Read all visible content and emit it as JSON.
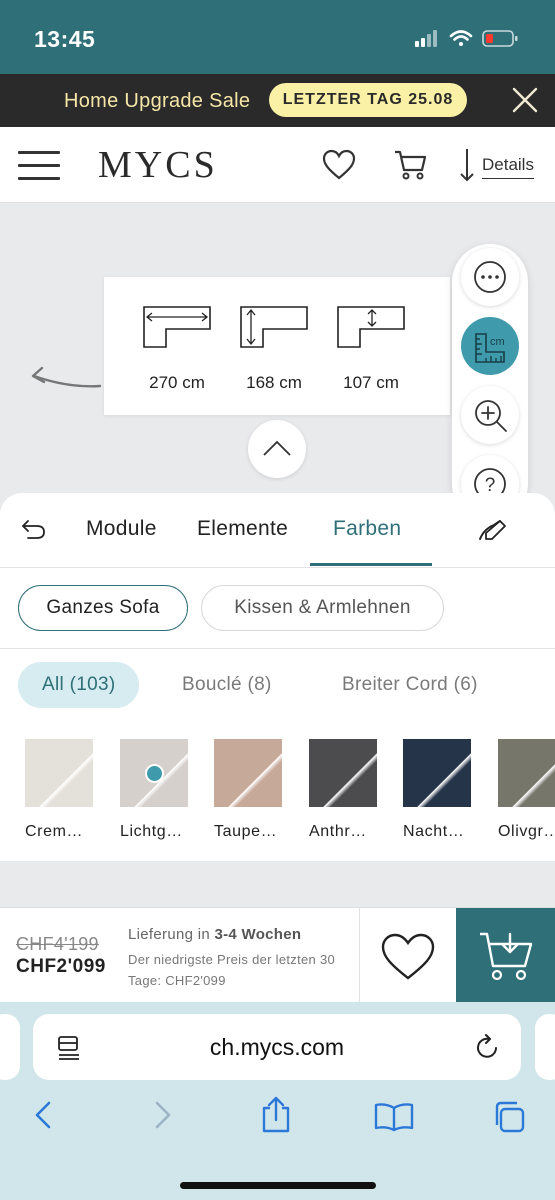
{
  "status_bar": {
    "time": "13:45"
  },
  "promo": {
    "text": "Home Upgrade Sale",
    "badge": "LETZTER TAG 25.08"
  },
  "header": {
    "logo": "MYCS",
    "details_label": "Details"
  },
  "dimensions": [
    {
      "label": "270 cm",
      "icon": "width-dimension-icon"
    },
    {
      "label": "168 cm",
      "icon": "depth-dimension-icon"
    },
    {
      "label": "107 cm",
      "icon": "seat-depth-dimension-icon"
    }
  ],
  "tool_rail": {
    "items": [
      {
        "icon": "more-options-icon"
      },
      {
        "icon": "measure-cm-icon",
        "text": "cm",
        "active": true
      },
      {
        "icon": "zoom-in-icon"
      },
      {
        "icon": "help-icon",
        "text": "?"
      }
    ]
  },
  "tabs": [
    {
      "label": "Module"
    },
    {
      "label": "Elemente"
    },
    {
      "label": "Farben",
      "active": true
    }
  ],
  "segments": [
    {
      "label": "Ganzes Sofa",
      "active": true
    },
    {
      "label": "Kissen & Armlehnen"
    }
  ],
  "filters": [
    {
      "label": "All (103)",
      "active": true
    },
    {
      "label": "Bouclé (8)"
    },
    {
      "label": "Breiter Cord (6)"
    }
  ],
  "swatches": [
    {
      "label": "Crem…",
      "color": "#e4e0da"
    },
    {
      "label": "Lichtg…",
      "color": "#d6d0cd",
      "selected": true
    },
    {
      "label": "Taupe…",
      "color": "#c7a99a"
    },
    {
      "label": "Anthr…",
      "color": "#4c4c4e"
    },
    {
      "label": "Nacht…",
      "color": "#26344a"
    },
    {
      "label": "Olivgr…",
      "color": "#76776a"
    }
  ],
  "cart": {
    "old_price": "CHF4'199",
    "new_price": "CHF2'099",
    "delivery_prefix": "Lieferung in ",
    "delivery_time": "3-4 Wochen",
    "lowest_price_note": "Der niedrigste Preis der letzten 30 Tage: CHF2'099"
  },
  "browser": {
    "url": "ch.mycs.com"
  },
  "colors": {
    "teal": "#2e6f78",
    "accent": "#3f9bab",
    "promo_badge": "#faf0a6"
  }
}
